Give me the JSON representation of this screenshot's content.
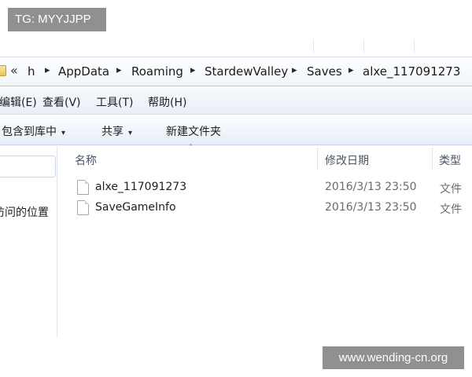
{
  "watermarks": {
    "top": "TG: MYYJJPP",
    "bottom": "www.wending-cn.org"
  },
  "address_bar": {
    "overflow_glyph": "«",
    "crumbs": [
      "h",
      "AppData",
      "Roaming",
      "StardewValley",
      "Saves",
      "alxe_117091273"
    ],
    "separator": "▸"
  },
  "menu_bar": {
    "items": [
      "编辑(E)",
      "查看(V)",
      "工具(T)",
      "帮助(H)"
    ]
  },
  "toolbar": {
    "include_library": "包含到库中",
    "share": "共享",
    "new_folder": "新建文件夹",
    "caret": "▾"
  },
  "nav_pane": {
    "recent_places": "访问的位置"
  },
  "file_list": {
    "sort_indicator": "˄",
    "columns": {
      "name": "名称",
      "modified": "修改日期",
      "type": "类型"
    },
    "rows": [
      {
        "name": "alxe_117091273",
        "modified": "2016/3/13 23:50",
        "type": "文件"
      },
      {
        "name": "SaveGameInfo",
        "modified": "2016/3/13 23:50",
        "type": "文件"
      }
    ]
  },
  "icons": {
    "folder": "folder-icon",
    "breadcrumb_separator": "chevron-right-icon",
    "dropdown": "chevron-down-icon",
    "file": "file-icon",
    "sort": "sort-ascending-icon"
  }
}
